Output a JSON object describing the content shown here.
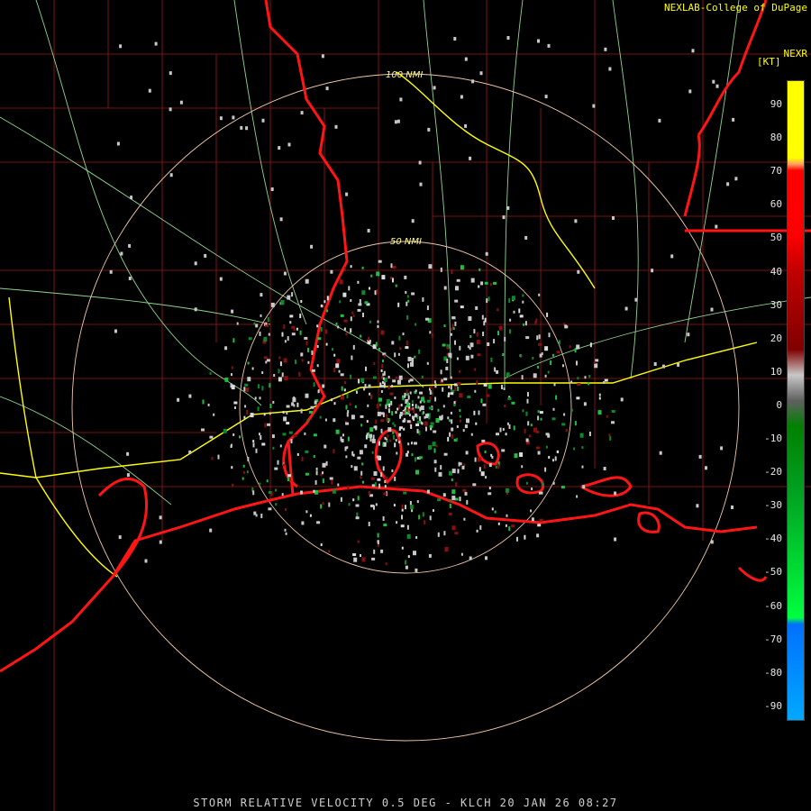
{
  "header": {
    "credit": "NEXLAB-College of DuPage",
    "product": "NEXR",
    "unit": "[KT]"
  },
  "footer": {
    "caption": "STORM RELATIVE VELOCITY 0.5 DEG - KLCH 20 JAN 26 08:27"
  },
  "range_rings": {
    "inner_label": "50 NMI",
    "outer_label": "100 NMI",
    "color": "#f0c8a8"
  },
  "legend": {
    "ticks": [
      "90",
      "80",
      "70",
      "60",
      "50",
      "40",
      "30",
      "20",
      "10",
      "0",
      "-10",
      "-20",
      "-30",
      "-40",
      "-50",
      "-60",
      "-70",
      "-80",
      "-90"
    ],
    "colors": {
      "outbound_high": "#ffff00",
      "outbound_mid": "#ff0000",
      "outbound_low": "#800000",
      "near_zero": "#bdbdbd",
      "inbound_low": "#008000",
      "inbound_mid": "#00ff40",
      "inbound_high": "#0070ff",
      "inbound_max": "#00a8ff"
    }
  },
  "map_colors": {
    "background": "#000000",
    "coastline": "#ff1010",
    "county_lines": "#b01818",
    "highways": "#9be39b",
    "interstates": "#ffff00"
  }
}
